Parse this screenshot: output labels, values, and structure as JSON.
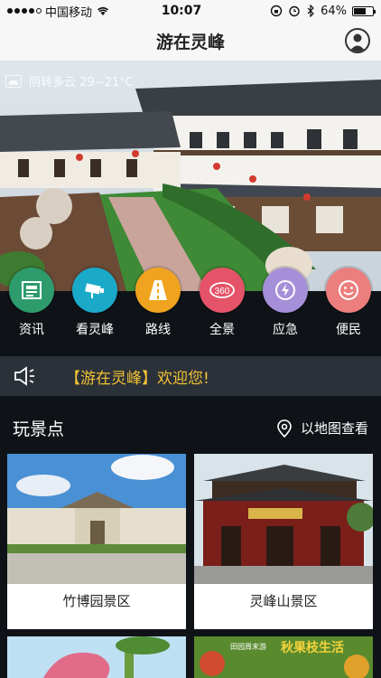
{
  "status": {
    "carrier": "中国移动",
    "time": "10:07",
    "battery_text": "64%",
    "battery_level": 0.64
  },
  "header": {
    "title": "游在灵峰"
  },
  "hero": {
    "weather": "阴转多云  29~21°C"
  },
  "menu": [
    {
      "label": "资讯",
      "icon": "news-icon",
      "color": "#2e9b6d"
    },
    {
      "label": "看灵峰",
      "icon": "camera-icon",
      "color": "#1aa9c9"
    },
    {
      "label": "路线",
      "icon": "road-icon",
      "color": "#f0a31e"
    },
    {
      "label": "全景",
      "icon": "panorama-360-icon",
      "color": "#e55368"
    },
    {
      "label": "应急",
      "icon": "emergency-icon",
      "color": "#a58fd8"
    },
    {
      "label": "便民",
      "icon": "smile-icon",
      "color": "#ec7e7e"
    }
  ],
  "notice": {
    "text": "【游在灵峰】欢迎您!"
  },
  "section": {
    "title": "玩景点",
    "map_link": "以地图查看"
  },
  "cards": [
    {
      "name": "竹博园景区"
    },
    {
      "name": "灵峰山景区"
    }
  ],
  "bottom_cards": [
    {
      "banner_top": "田园周末游",
      "banner_main": "秋果枝生活"
    }
  ]
}
